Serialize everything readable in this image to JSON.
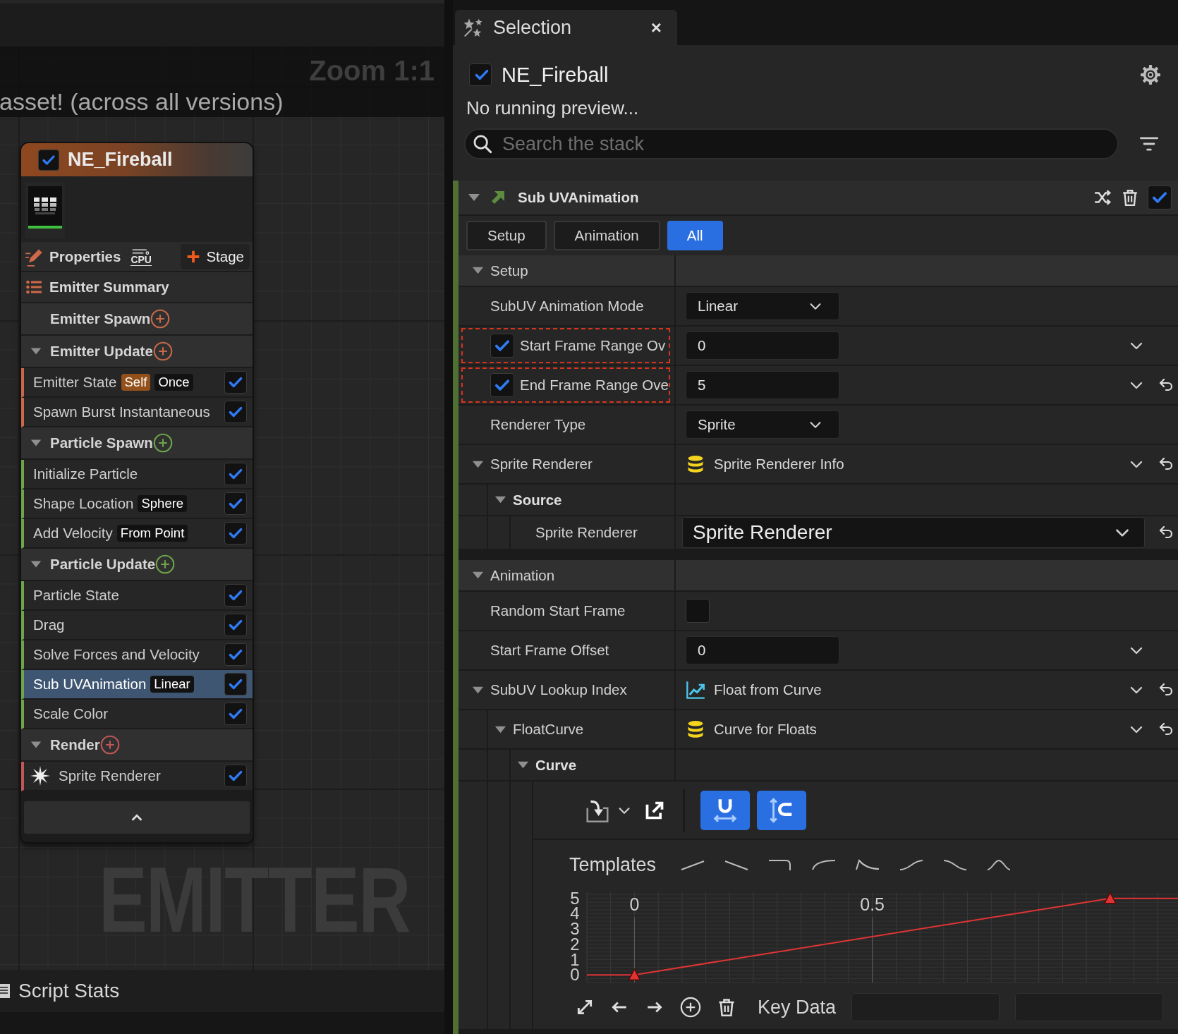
{
  "graph": {
    "banner": "asset! (across all versions)",
    "zoom": "Zoom 1:1",
    "stage_label": "EMITTER"
  },
  "node": {
    "title": "NE_Fireball",
    "enabled": true,
    "properties": "Properties",
    "sim_target": "CPU",
    "stage_button": "Stage",
    "summary": "Emitter Summary",
    "groups": [
      {
        "label": "Emitter Spawn",
        "color": "#c8694a"
      },
      {
        "label": "Emitter Update",
        "expanded": true,
        "color": "#c8694a",
        "modules": [
          {
            "label": "Emitter State",
            "kind": "module",
            "tags": [
              {
                "text": "Self",
                "kind": "scope"
              },
              {
                "text": "Once",
                "kind": "value"
              }
            ],
            "enabled": true,
            "selected": false
          },
          {
            "label": "Spawn Burst Instantaneous",
            "kind": "module",
            "enabled": true,
            "selected": false
          }
        ]
      },
      {
        "label": "Particle Spawn",
        "expanded": true,
        "color": "#6da54a",
        "modules": [
          {
            "label": "Initialize Particle",
            "kind": "module",
            "enabled": true,
            "selected": false
          },
          {
            "label": "Shape Location",
            "kind": "module",
            "tags": [
              {
                "text": "Sphere",
                "kind": "value"
              }
            ],
            "enabled": true,
            "selected": false
          },
          {
            "label": "Add Velocity",
            "kind": "module",
            "tags": [
              {
                "text": "From Point",
                "kind": "value"
              }
            ],
            "enabled": true,
            "selected": false
          }
        ]
      },
      {
        "label": "Particle Update",
        "expanded": true,
        "color": "#6da54a",
        "modules": [
          {
            "label": "Particle State",
            "kind": "module",
            "enabled": true,
            "selected": false
          },
          {
            "label": "Drag",
            "kind": "module",
            "enabled": true,
            "selected": false
          },
          {
            "label": "Solve Forces and Velocity",
            "kind": "module",
            "enabled": true,
            "selected": false
          },
          {
            "label": "Sub UVAnimation",
            "kind": "module",
            "tags": [
              {
                "text": "Linear",
                "kind": "value"
              }
            ],
            "enabled": true,
            "selected": true
          },
          {
            "label": "Scale Color",
            "kind": "module",
            "enabled": true,
            "selected": false
          }
        ]
      },
      {
        "label": "Render",
        "expanded": true,
        "color": "#c05656",
        "modules": [
          {
            "label": "Sprite Renderer",
            "kind": "renderer",
            "enabled": true,
            "selected": false
          }
        ]
      }
    ]
  },
  "script_stats": "Script Stats",
  "selection": {
    "tab": {
      "label": "Selection",
      "close": "×",
      "selected": true
    },
    "emitter": {
      "name": "NE_Fireball",
      "enabled": true
    },
    "status": "No running preview...",
    "search": {
      "placeholder": "Search the stack"
    },
    "module": {
      "name": "Sub UVAnimation",
      "enabled": true,
      "expanded": true
    },
    "filters": [
      {
        "label": "Setup",
        "selected": false
      },
      {
        "label": "Animation",
        "selected": false
      },
      {
        "label": "All",
        "selected": true
      }
    ],
    "sections": [
      {
        "label": "Setup",
        "expanded": true,
        "children": [
          {
            "kind": "dropdown",
            "label": "SubUV Animation Mode",
            "value": "Linear"
          },
          {
            "kind": "number",
            "label": "Start Frame Range Ov",
            "override": true,
            "highlighted": true,
            "value": "0",
            "reset": false
          },
          {
            "kind": "number",
            "label": "End Frame Range Ove",
            "override": true,
            "highlighted": true,
            "value": "5",
            "reset": true
          },
          {
            "kind": "dropdown",
            "label": "Renderer Type",
            "value": "Sprite"
          },
          {
            "kind": "data-asset",
            "label": "Sprite Renderer",
            "value": "Sprite Renderer Info",
            "expanded": true,
            "reset": true,
            "children": [
              {
                "kind": "category",
                "label": "Source",
                "expanded": true,
                "children": [
                  {
                    "kind": "picker",
                    "label": "Sprite Renderer",
                    "value": "Sprite Renderer",
                    "reset": true
                  }
                ]
              }
            ]
          }
        ]
      },
      {
        "label": "Animation",
        "expanded": true,
        "children": [
          {
            "kind": "toggle",
            "label": "Random Start Frame",
            "checked": false
          },
          {
            "kind": "number",
            "label": "Start Frame Offset",
            "value": "0",
            "reset": false
          },
          {
            "kind": "curve-asset",
            "label": "SubUV Lookup Index",
            "value": "Float from Curve",
            "expanded": true,
            "reset": true,
            "children": [
              {
                "kind": "data-asset",
                "label": "FloatCurve",
                "value": "Curve for Floats",
                "expanded": true,
                "reset": true,
                "children": [
                  {
                    "kind": "curve",
                    "label": "Curve",
                    "expanded": true,
                    "editor": {
                      "tools": [
                        {
                          "kind": "import"
                        },
                        {
                          "kind": "export"
                        },
                        {
                          "kind": "snap-time",
                          "on": true
                        },
                        {
                          "kind": "snap-value",
                          "on": true
                        }
                      ],
                      "templates_label": "Templates",
                      "templates": [
                        {
                          "kind": "linear-up"
                        },
                        {
                          "kind": "linear-down"
                        },
                        {
                          "kind": "step"
                        },
                        {
                          "kind": "ease-out"
                        },
                        {
                          "kind": "decay"
                        },
                        {
                          "kind": "s-up"
                        },
                        {
                          "kind": "s-down"
                        },
                        {
                          "kind": "bell"
                        }
                      ],
                      "chart_data": {
                        "type": "line",
                        "x": [
                          -0.1,
                          0,
                          1,
                          1.15
                        ],
                        "series": [
                          {
                            "color": "#e03434",
                            "values": [
                              0,
                              0,
                              5,
                              5
                            ],
                            "marker": "triangle"
                          }
                        ],
                        "xlim": [
                          -0.1,
                          1.15
                        ],
                        "ylim": [
                          -0.5,
                          5.4
                        ],
                        "grid": true,
                        "xticks": [
                          0,
                          0.5
                        ],
                        "yticks": [
                          0,
                          1,
                          2,
                          3,
                          4,
                          5
                        ]
                      },
                      "key_label": "Key Data"
                    }
                  }
                ]
              }
            ]
          }
        ]
      }
    ]
  }
}
